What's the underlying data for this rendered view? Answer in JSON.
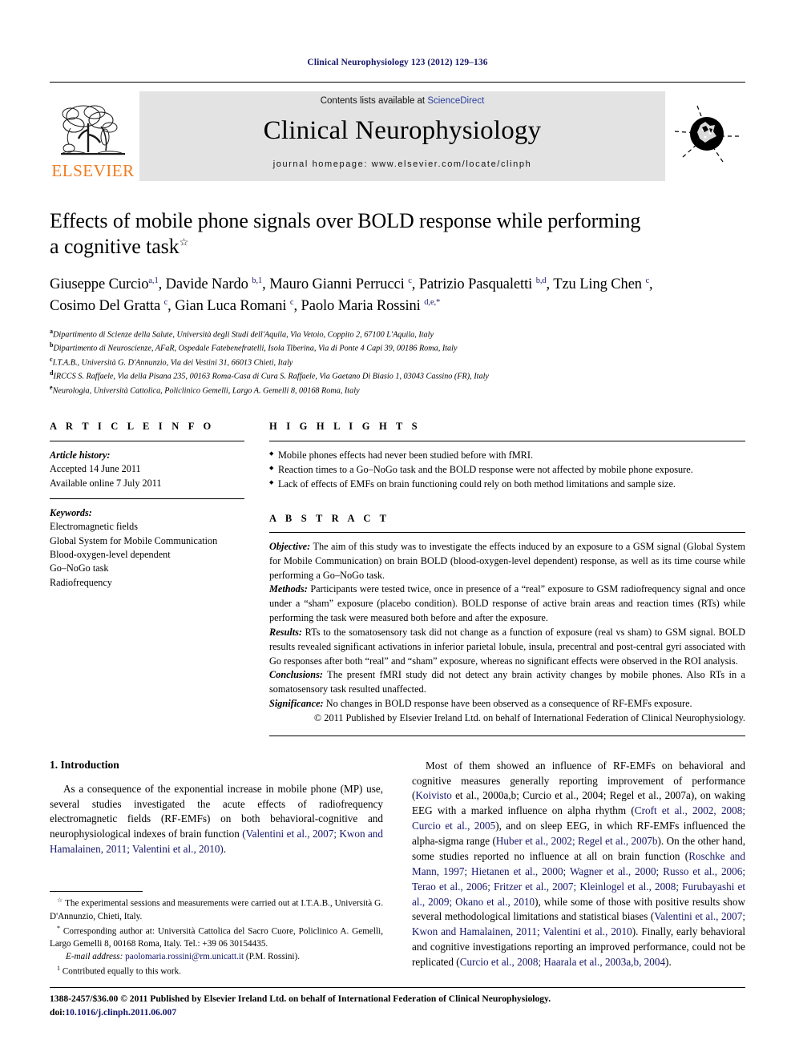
{
  "running_head": "Clinical Neurophysiology 123 (2012) 129–136",
  "masthead": {
    "publisher_name": "ELSEVIER",
    "contents_prefix": "Contents lists available at ",
    "sciencedirect": "ScienceDirect",
    "journal_title": "Clinical Neurophysiology",
    "homepage": "journal homepage: www.elsevier.com/locate/clinph"
  },
  "article": {
    "title_line1": "Effects of mobile phone signals over BOLD response while performing",
    "title_line2": "a cognitive task",
    "title_footnote_mark": "☆",
    "authors_line1": "Giuseppe Curcio a,1, Davide Nardo b,1, Mauro Gianni Perrucci c, Patrizio Pasqualetti b,d, Tzu Ling Chen c,",
    "authors_line2": "Cosimo Del Gratta c, Gian Luca Romani c, Paolo Maria Rossini d,e,*",
    "authors": [
      {
        "name": "Giuseppe Curcio",
        "sup": "a,1"
      },
      {
        "name": "Davide Nardo",
        "sup": "b,1"
      },
      {
        "name": "Mauro Gianni Perrucci",
        "sup": "c"
      },
      {
        "name": "Patrizio Pasqualetti",
        "sup": "b,d"
      },
      {
        "name": "Tzu Ling Chen",
        "sup": "c"
      },
      {
        "name": "Cosimo Del Gratta",
        "sup": "c"
      },
      {
        "name": "Gian Luca Romani",
        "sup": "c"
      },
      {
        "name": "Paolo Maria Rossini",
        "sup": "d,e,*"
      }
    ],
    "affiliations": [
      {
        "mark": "a",
        "text": "Dipartimento di Scienze della Salute, Università degli Studi dell'Aquila, Via Vetoio, Coppito 2, 67100 L'Aquila, Italy"
      },
      {
        "mark": "b",
        "text": "Dipartimento di Neuroscienze, AFaR, Ospedale Fatebenefratelli, Isola Tiberina, Via di Ponte 4 Capi 39, 00186 Roma, Italy"
      },
      {
        "mark": "c",
        "text": "I.T.A.B., Università G. D'Annunzio, Via dei Vestini 31, 66013 Chieti, Italy"
      },
      {
        "mark": "d",
        "text": "IRCCS S. Raffaele, Via della Pisana 235, 00163 Roma-Casa di Cura S. Raffaele, Via Gaetano Di Biasio 1, 03043 Cassino (FR), Italy"
      },
      {
        "mark": "e",
        "text": "Neurologia, Università Cattolica, Policlinico Gemelli, Largo A. Gemelli 8, 00168 Roma, Italy"
      }
    ]
  },
  "article_info": {
    "heading": "A R T I C L E  I N F O",
    "history_label": "Article history:",
    "history": [
      "Accepted 14 June 2011",
      "Available online 7 July 2011"
    ],
    "keywords_label": "Keywords:",
    "keywords": [
      "Electromagnetic fields",
      "Global System for Mobile Communication",
      "Blood-oxygen-level dependent",
      "Go–NoGo task",
      "Radiofrequency"
    ]
  },
  "highlights": {
    "heading": "H I G H L I G H T S",
    "items": [
      "Mobile phones effects had never been studied before with fMRI.",
      "Reaction times to a Go–NoGo task and the BOLD response were not affected by mobile phone exposure.",
      "Lack of effects of EMFs on brain functioning could rely on both method limitations and sample size."
    ]
  },
  "abstract": {
    "heading": "A B S T R A C T",
    "sections": [
      {
        "label": "Objective:",
        "text": " The aim of this study was to investigate the effects induced by an exposure to a GSM signal (Global System for Mobile Communication) on brain BOLD (blood-oxygen-level dependent) response, as well as its time course while performing a Go–NoGo task."
      },
      {
        "label": "Methods:",
        "text": " Participants were tested twice, once in presence of a “real” exposure to GSM radiofrequency signal and once under a “sham” exposure (placebo condition). BOLD response of active brain areas and reaction times (RTs) while performing the task were measured both before and after the exposure."
      },
      {
        "label": "Results:",
        "text": " RTs to the somatosensory task did not change as a function of exposure (real vs sham) to GSM signal. BOLD results revealed significant activations in inferior parietal lobule, insula, precentral and post-central gyri associated with Go responses after both “real” and “sham” exposure, whereas no significant effects were observed in the ROI analysis."
      },
      {
        "label": "Conclusions:",
        "text": " The present fMRI study did not detect any brain activity changes by mobile phones. Also RTs in a somatosensory task resulted unaffected."
      },
      {
        "label": "Significance:",
        "text": " No changes in BOLD response have been observed as a consequence of RF-EMFs exposure."
      }
    ],
    "copyright": "© 2011 Published by Elsevier Ireland Ltd. on behalf of International Federation of Clinical Neurophysiology."
  },
  "body": {
    "section1_heading": "1. Introduction",
    "left_paragraph": "As a consequence of the exponential increase in mobile phone (MP) use, several studies investigated the acute effects of radiofrequency electromagnetic fields (RF-EMFs) on both behavioral-cognitive and neurophysiological indexes of brain function (Valentini et al., 2007; Kwon and Hamalainen, 2011; Valentini et al., 2010).",
    "left_paragraph_plain": "As a consequence of the exponential increase in mobile phone (MP) use, several studies investigated the acute effects of radiofrequency electromagnetic fields (RF-EMFs) on both behavioral-cognitive and neurophysiological indexes of brain function ",
    "left_paragraph_cite": "(Valentini et al., 2007; Kwon and Hamalainen, 2011; Valentini et al., 2010)",
    "left_paragraph_end": ".",
    "right_paragraph_parts": [
      {
        "type": "text",
        "value": "Most of them showed an influence of RF-EMFs on behavioral and cognitive measures generally reporting improvement of performance ("
      },
      {
        "type": "cite",
        "value": "Koivisto"
      },
      {
        "type": "text",
        "value": " et al., 2000a,b; Curcio et al., 2004; Regel et al., 2007a"
      },
      {
        "type": "text",
        "value": "), on waking EEG with a marked influence on alpha rhythm ("
      },
      {
        "type": "cite",
        "value": "Croft et al., 2002, 2008; Curcio et al., 2005"
      },
      {
        "type": "text",
        "value": "), and on sleep EEG, in which RF-EMFs influenced the alpha-sigma range ("
      },
      {
        "type": "cite",
        "value": "Huber et al., 2002; Regel et al., 2007b"
      },
      {
        "type": "text",
        "value": "). On the other hand, some studies reported no influence at all on brain function ("
      },
      {
        "type": "cite",
        "value": "Roschke and Mann, 1997; Hietanen et al., 2000; Wagner et al., 2000; Russo et al., 2006; Terao et al., 2006; Fritzer et al., 2007; Kleinlogel et al., 2008; Furubayashi et al., 2009; Okano et al., 2010"
      },
      {
        "type": "text",
        "value": "), while some of those with positive results show several methodological limitations and statistical biases ("
      },
      {
        "type": "cite",
        "value": "Valentini et al., 2007; Kwon and Hamalainen, 2011; Valentini et al., 2010"
      },
      {
        "type": "text",
        "value": "). Finally, early behavioral and cognitive investigations reporting an improved performance, could not be replicated ("
      },
      {
        "type": "cite",
        "value": "Curcio et al., 2008; Haarala et al., 2003a,b, 2004"
      },
      {
        "type": "text",
        "value": ")."
      }
    ]
  },
  "footnotes": [
    {
      "mark": "☆",
      "text": " The experimental sessions and measurements were carried out at I.T.A.B., Università G. D'Annunzio, Chieti, Italy."
    },
    {
      "mark": "*",
      "text": " Corresponding author at: Università Cattolica del Sacro Cuore, Policlinico A. Gemelli, Largo Gemelli 8, 00168 Roma, Italy. Tel.: +39 06 30154435."
    },
    {
      "mark": "",
      "label": "E-mail address:",
      "email": "paolomaria.rossini@rm.unicatt.it",
      "suffix": " (P.M. Rossini)."
    },
    {
      "mark": "1",
      "text": " Contributed equally to this work."
    }
  ],
  "page_footer": {
    "line1": "1388-2457/$36.00 © 2011 Published by Elsevier Ireland Ltd. on behalf of International Federation of Clinical Neurophysiology.",
    "doi_label": "doi:",
    "doi_value": "10.1016/j.clinph.2011.06.007"
  },
  "colors": {
    "link_blue": "#16166b",
    "sciencedirect_blue": "#2b3f9e",
    "elsevier_orange": "#f07c1e",
    "band_gray": "#e3e3e3"
  }
}
